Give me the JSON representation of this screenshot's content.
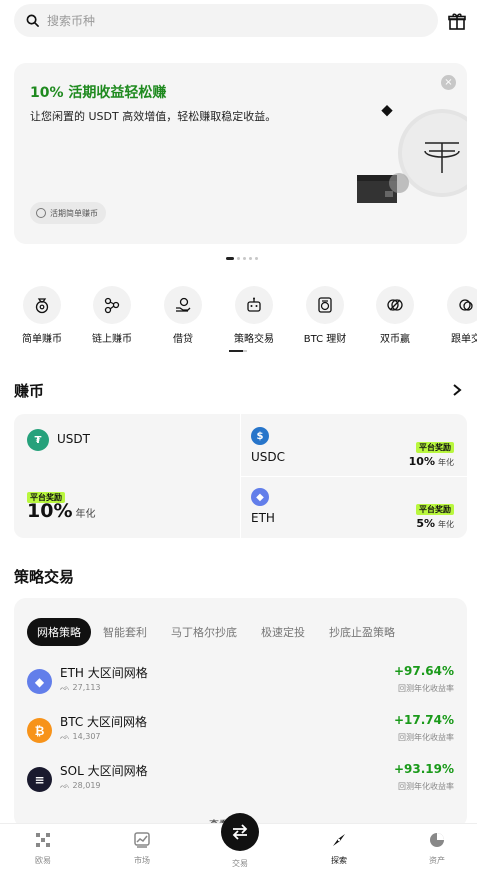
{
  "search": {
    "placeholder": "搜索币种"
  },
  "banner": {
    "title": "10% 活期收益轻松赚",
    "description": "让您闲置的 USDT 高效增值，轻松赚取稳定收益。",
    "chip_label": "活期简单赚币"
  },
  "quick_actions": [
    {
      "label": "简单赚币",
      "icon": "money-bag-icon"
    },
    {
      "label": "链上赚币",
      "icon": "nodes-icon"
    },
    {
      "label": "借贷",
      "icon": "hand-coin-icon"
    },
    {
      "label": "策略交易",
      "icon": "robot-icon"
    },
    {
      "label": "BTC 理财",
      "icon": "bitcoin-doc-icon"
    },
    {
      "label": "双币赢",
      "icon": "dual-coin-icon"
    },
    {
      "label": "跟单交",
      "icon": "copy-trade-icon"
    }
  ],
  "earn": {
    "title": "赚币",
    "items": [
      {
        "coin": "USDT",
        "badge": "平台奖励",
        "rate": "10%",
        "unit": "年化",
        "color": "#26a17b"
      },
      {
        "coin": "USDC",
        "badge": "平台奖励",
        "rate": "10%",
        "unit": "年化",
        "color": "#2775ca"
      },
      {
        "coin": "ETH",
        "badge": "平台奖励",
        "rate": "5%",
        "unit": "年化",
        "color": "#627eea"
      }
    ]
  },
  "strategy": {
    "title": "策略交易",
    "tabs": [
      "网格策略",
      "智能套利",
      "马丁格尔抄底",
      "极速定投",
      "抄底止盈策略"
    ],
    "rows": [
      {
        "name": "ETH 大区间网格",
        "count": "27,113",
        "return": "+97.64%",
        "return_label": "回测年化收益率",
        "icon": "ethereum-icon",
        "color": "#627eea"
      },
      {
        "name": "BTC 大区间网格",
        "count": "14,307",
        "return": "+17.74%",
        "return_label": "回测年化收益率",
        "icon": "bitcoin-icon",
        "color": "#f7931a"
      },
      {
        "name": "SOL 大区间网格",
        "count": "28,019",
        "return": "+93.19%",
        "return_label": "回测年化收益率",
        "icon": "solana-icon",
        "color": "#1a1a2e"
      }
    ],
    "more_label": "查看更多"
  },
  "nav": [
    {
      "label": "欧易",
      "icon": "okx-logo-icon"
    },
    {
      "label": "市场",
      "icon": "chart-icon"
    },
    {
      "label": "交易",
      "icon": "swap-icon"
    },
    {
      "label": "探索",
      "icon": "compass-icon"
    },
    {
      "label": "资产",
      "icon": "pie-icon"
    }
  ],
  "colors": {
    "accent_green": "#1f8a1f",
    "badge_lime": "#b9f73e"
  }
}
